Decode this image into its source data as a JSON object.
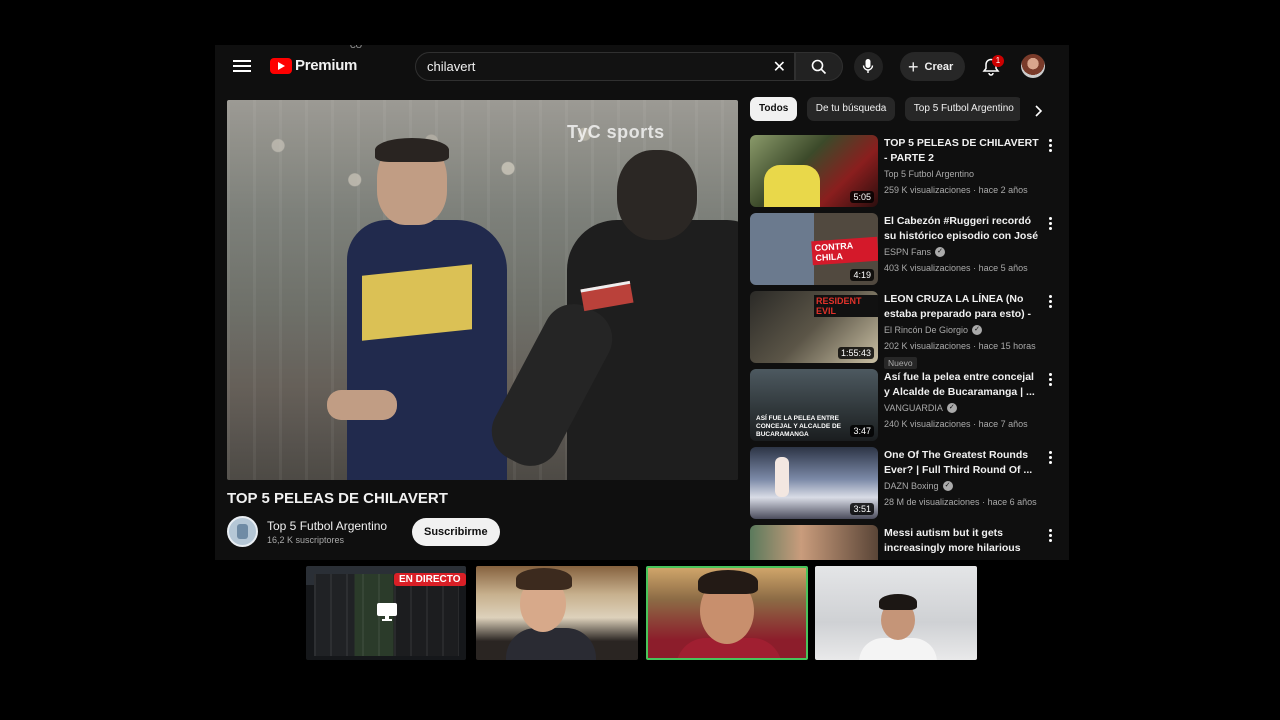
{
  "header": {
    "logo_text": "Premium",
    "logo_country": "CO",
    "search_value": "chilavert",
    "create_label": "Crear",
    "notification_count": "1"
  },
  "video": {
    "watermark": "TyC sports",
    "title": "TOP 5 PELEAS DE CHILAVERT",
    "channel": "Top 5 Futbol Argentino",
    "subscribers": "16,2 K suscriptores",
    "subscribe_label": "Suscribirme"
  },
  "chips": [
    "Todos",
    "De tu búsqueda",
    "Top 5 Futbol Argentino"
  ],
  "recommendations": [
    {
      "title": "TOP 5 PELEAS DE CHILAVERT - PARTE 2",
      "channel": "Top 5 Futbol Argentino",
      "views": "259 K visualizaciones",
      "age": "hace 2 años",
      "duration": "5:05",
      "verified": false
    },
    {
      "title": "El Cabezón #Ruggeri recordó su histórico episodio con José Lu...",
      "channel": "ESPN Fans",
      "views": "403 K visualizaciones",
      "age": "hace 5 años",
      "duration": "4:19",
      "verified": true
    },
    {
      "title": "LEON CRUZA LA LÍNEA (No estaba preparado para esto) - ...",
      "channel": "El Rincón De Giorgio",
      "views": "202 K visualizaciones",
      "age": "hace 15 horas",
      "duration": "1:55:43",
      "verified": true,
      "badge": "Nuevo"
    },
    {
      "title": "Así fue la pelea entre concejal y Alcalde de Bucaramanga | ...",
      "channel": "VANGUARDIA",
      "views": "240 K visualizaciones",
      "age": "hace 7 años",
      "duration": "3:47",
      "verified": true
    },
    {
      "title": "One Of The Greatest Rounds Ever? | Full Third Round Of ...",
      "channel": "DAZN Boxing",
      "views": "28 M de visualizaciones",
      "age": "hace 6 años",
      "duration": "3:51",
      "verified": true
    },
    {
      "title": "Messi autism but it gets increasingly more hilarious",
      "channel": "",
      "views": "",
      "age": "",
      "duration": "",
      "verified": false
    }
  ],
  "meeting": {
    "live_label": "EN DIRECTO"
  },
  "icons": {
    "menu": "menu-icon",
    "search": "search-icon",
    "clear": "close-icon",
    "mic": "mic-icon",
    "create": "plus-icon",
    "bell": "bell-icon",
    "more": "more-vert-icon",
    "next": "chevron-right-icon",
    "screen": "screen-share-icon"
  },
  "colors": {
    "brand_red": "#ff0000",
    "background": "#0f0f0f",
    "live_red": "#d91f26",
    "speaker_border": "#48c45b"
  }
}
